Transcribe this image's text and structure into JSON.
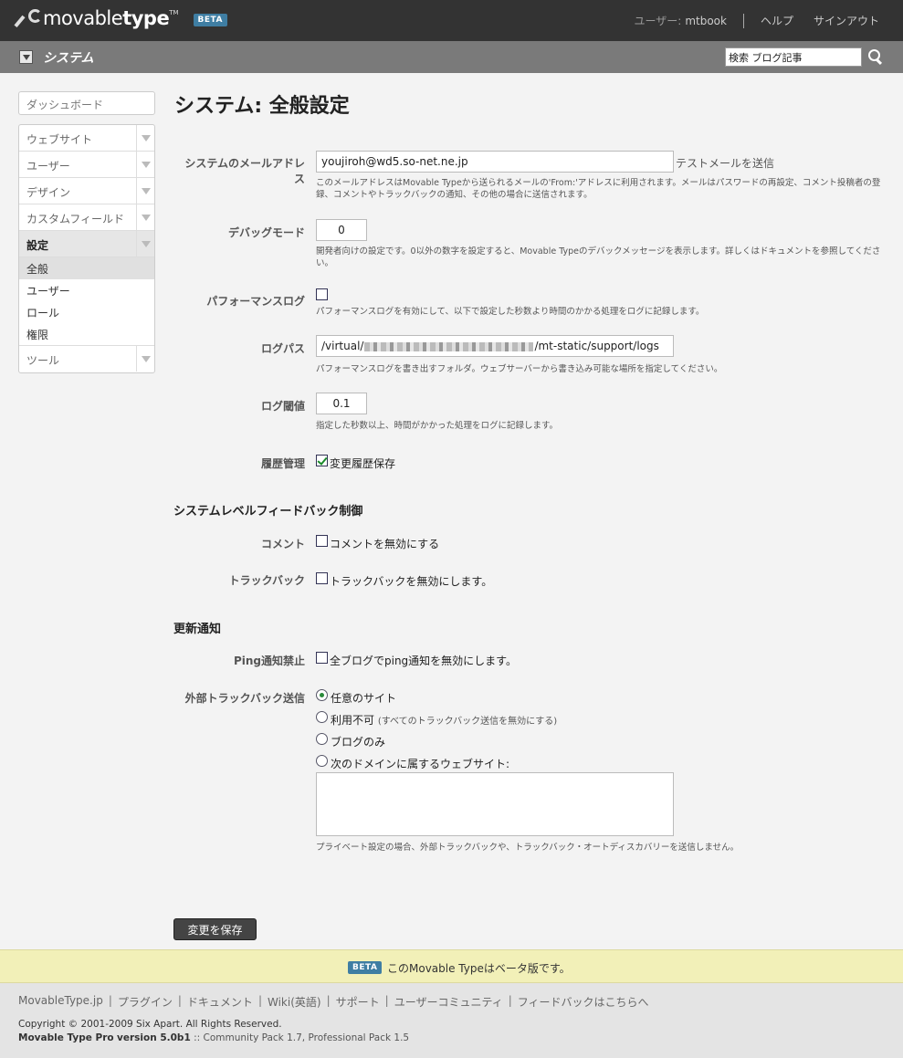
{
  "header": {
    "brand_light": "movable",
    "brand_bold": "type",
    "tm": "TM",
    "beta": "BETA",
    "user_label": "ユーザー:",
    "user_name": "mtbook",
    "help": "ヘルプ",
    "signout": "サインアウト"
  },
  "sysbar": {
    "title": "システム",
    "search_value": "検索 ブログ記事"
  },
  "sidebar": {
    "dashboard": "ダッシュボード",
    "items": [
      {
        "label": "ウェブサイト"
      },
      {
        "label": "ユーザー"
      },
      {
        "label": "デザイン"
      },
      {
        "label": "カスタムフィールド"
      },
      {
        "label": "設定"
      }
    ],
    "subitems": [
      "全般",
      "ユーザー",
      "ロール",
      "権限"
    ],
    "tools": "ツール"
  },
  "main": {
    "title": "システム: 全般設定",
    "email": {
      "label": "システムのメールアドレス",
      "value": "youjiroh@wd5.so-net.ne.jp",
      "test_link": "テストメールを送信",
      "hint": "このメールアドレスはMovable Typeから送られるメールの'From:'アドレスに利用されます。メールはパスワードの再設定、コメント投稿者の登録、コメントやトラックバックの通知、その他の場合に送信されます。"
    },
    "debug": {
      "label": "デバッグモード",
      "value": "0",
      "hint": "開発者向けの設定です。0以外の数字を設定すると、Movable Typeのデバックメッセージを表示します。詳しくはドキュメントを参照してください。"
    },
    "perflog": {
      "label": "パフォーマンスログ",
      "hint": "パフォーマンスログを有効にして、以下で設定した秒数より時間のかかる処理をログに記録します。"
    },
    "logpath": {
      "label": "ログパス",
      "prefix": "/virtual/",
      "suffix": "/mt-static/support/logs",
      "hint": "パフォーマンスログを書き出すフォルダ。ウェブサーバーから書き込み可能な場所を指定してください。"
    },
    "threshold": {
      "label": "ログ閾値",
      "value": "0.1",
      "hint": "指定した秒数以上、時間がかかった処理をログに記録します。"
    },
    "history": {
      "label": "履歴管理",
      "option": "変更履歴保存"
    },
    "feedback_section": "システムレベルフィードバック制御",
    "comment": {
      "label": "コメント",
      "option": "コメントを無効にする"
    },
    "trackback": {
      "label": "トラックバック",
      "option": "トラックバックを無効にします。"
    },
    "update_section": "更新通知",
    "ping": {
      "label": "Ping通知禁止",
      "option": "全ブログでping通知を無効にします。"
    },
    "outbound": {
      "label": "外部トラックバック送信",
      "opt_any": "任意のサイト",
      "opt_disabled": "利用不可",
      "opt_disabled_note": "(すべてのトラックバック送信を無効にする)",
      "opt_blog": "ブログのみ",
      "opt_domain": "次のドメインに属するウェブサイト:",
      "hint": "プライベート設定の場合、外部トラックバックや、トラックバック・オートディスカバリーを送信しません。"
    },
    "save": "変更を保存"
  },
  "beta_bar": {
    "badge": "BETA",
    "message": "このMovable Typeはベータ版です。"
  },
  "footer": {
    "links": [
      "MovableType.jp",
      "プラグイン",
      "ドキュメント",
      "Wiki(英語)",
      "サポート",
      "ユーザーコミュニティ",
      "フィードバックはこちらへ"
    ],
    "copyright": "Copyright © 2001-2009 Six Apart. All Rights Reserved.",
    "product": "Movable Type Pro",
    "version": "version 5.0b1",
    "packs": ":: Community Pack 1.7, Professional Pack 1.5"
  }
}
